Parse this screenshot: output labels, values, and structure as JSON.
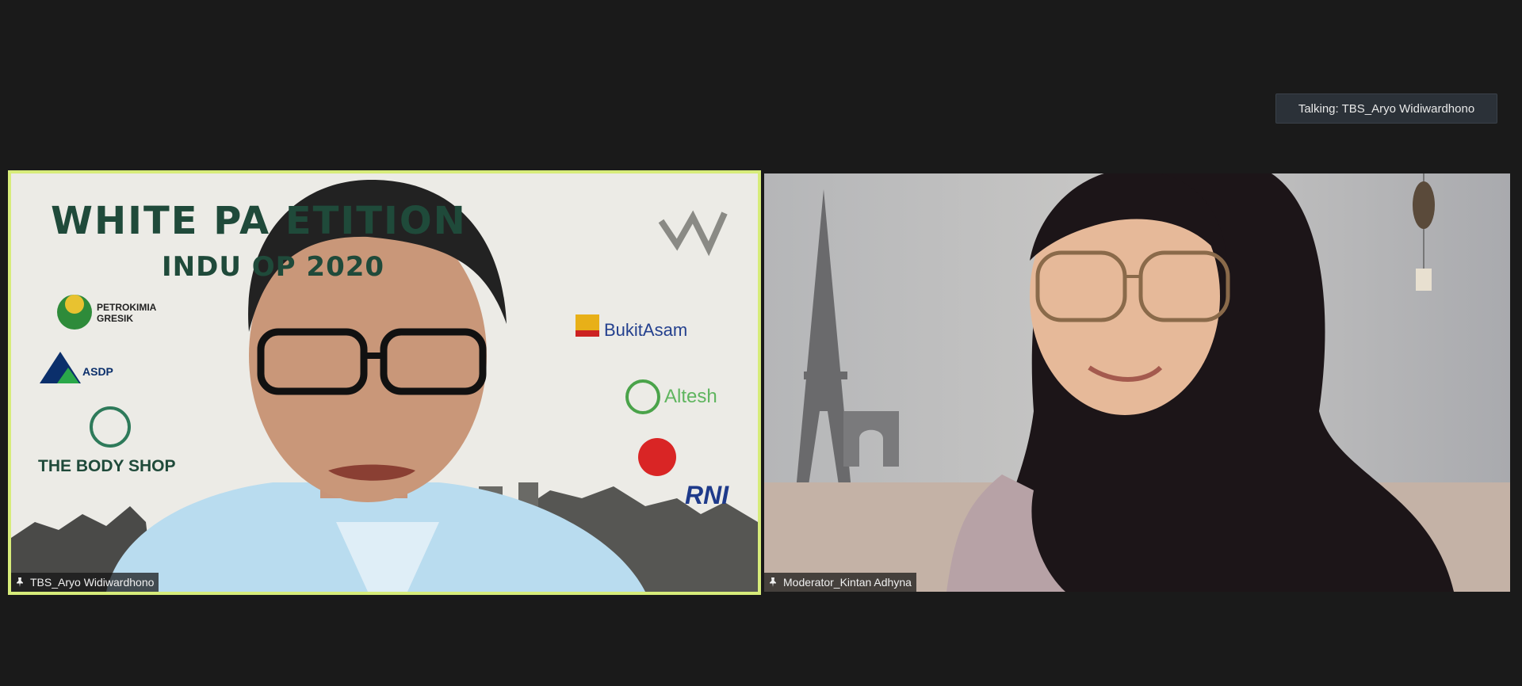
{
  "meeting": {
    "talking_indicator": "Talking: TBS_Aryo Widiwardhono"
  },
  "participants": [
    {
      "name": "TBS_Aryo Widiwardhono",
      "active_speaker": true,
      "backdrop": {
        "title_line1": "WHITE PA    ETITION",
        "title_line2": "INDU           OP 2020",
        "logos": {
          "petrokimia": "PETROKIMIA",
          "gresik": "GRESIK",
          "asdp": "ASDP",
          "bodyshop": "THE BODY SHOP",
          "bukitasam": "BukitAsam",
          "altesh": "Altesh",
          "rni": "RNI"
        }
      }
    },
    {
      "name": "Moderator_Kintan Adhyna",
      "active_speaker": false
    }
  ],
  "colors": {
    "background": "#1a1a1a",
    "active_border": "#d7ec7a",
    "badge_bg": "#2b3138"
  }
}
